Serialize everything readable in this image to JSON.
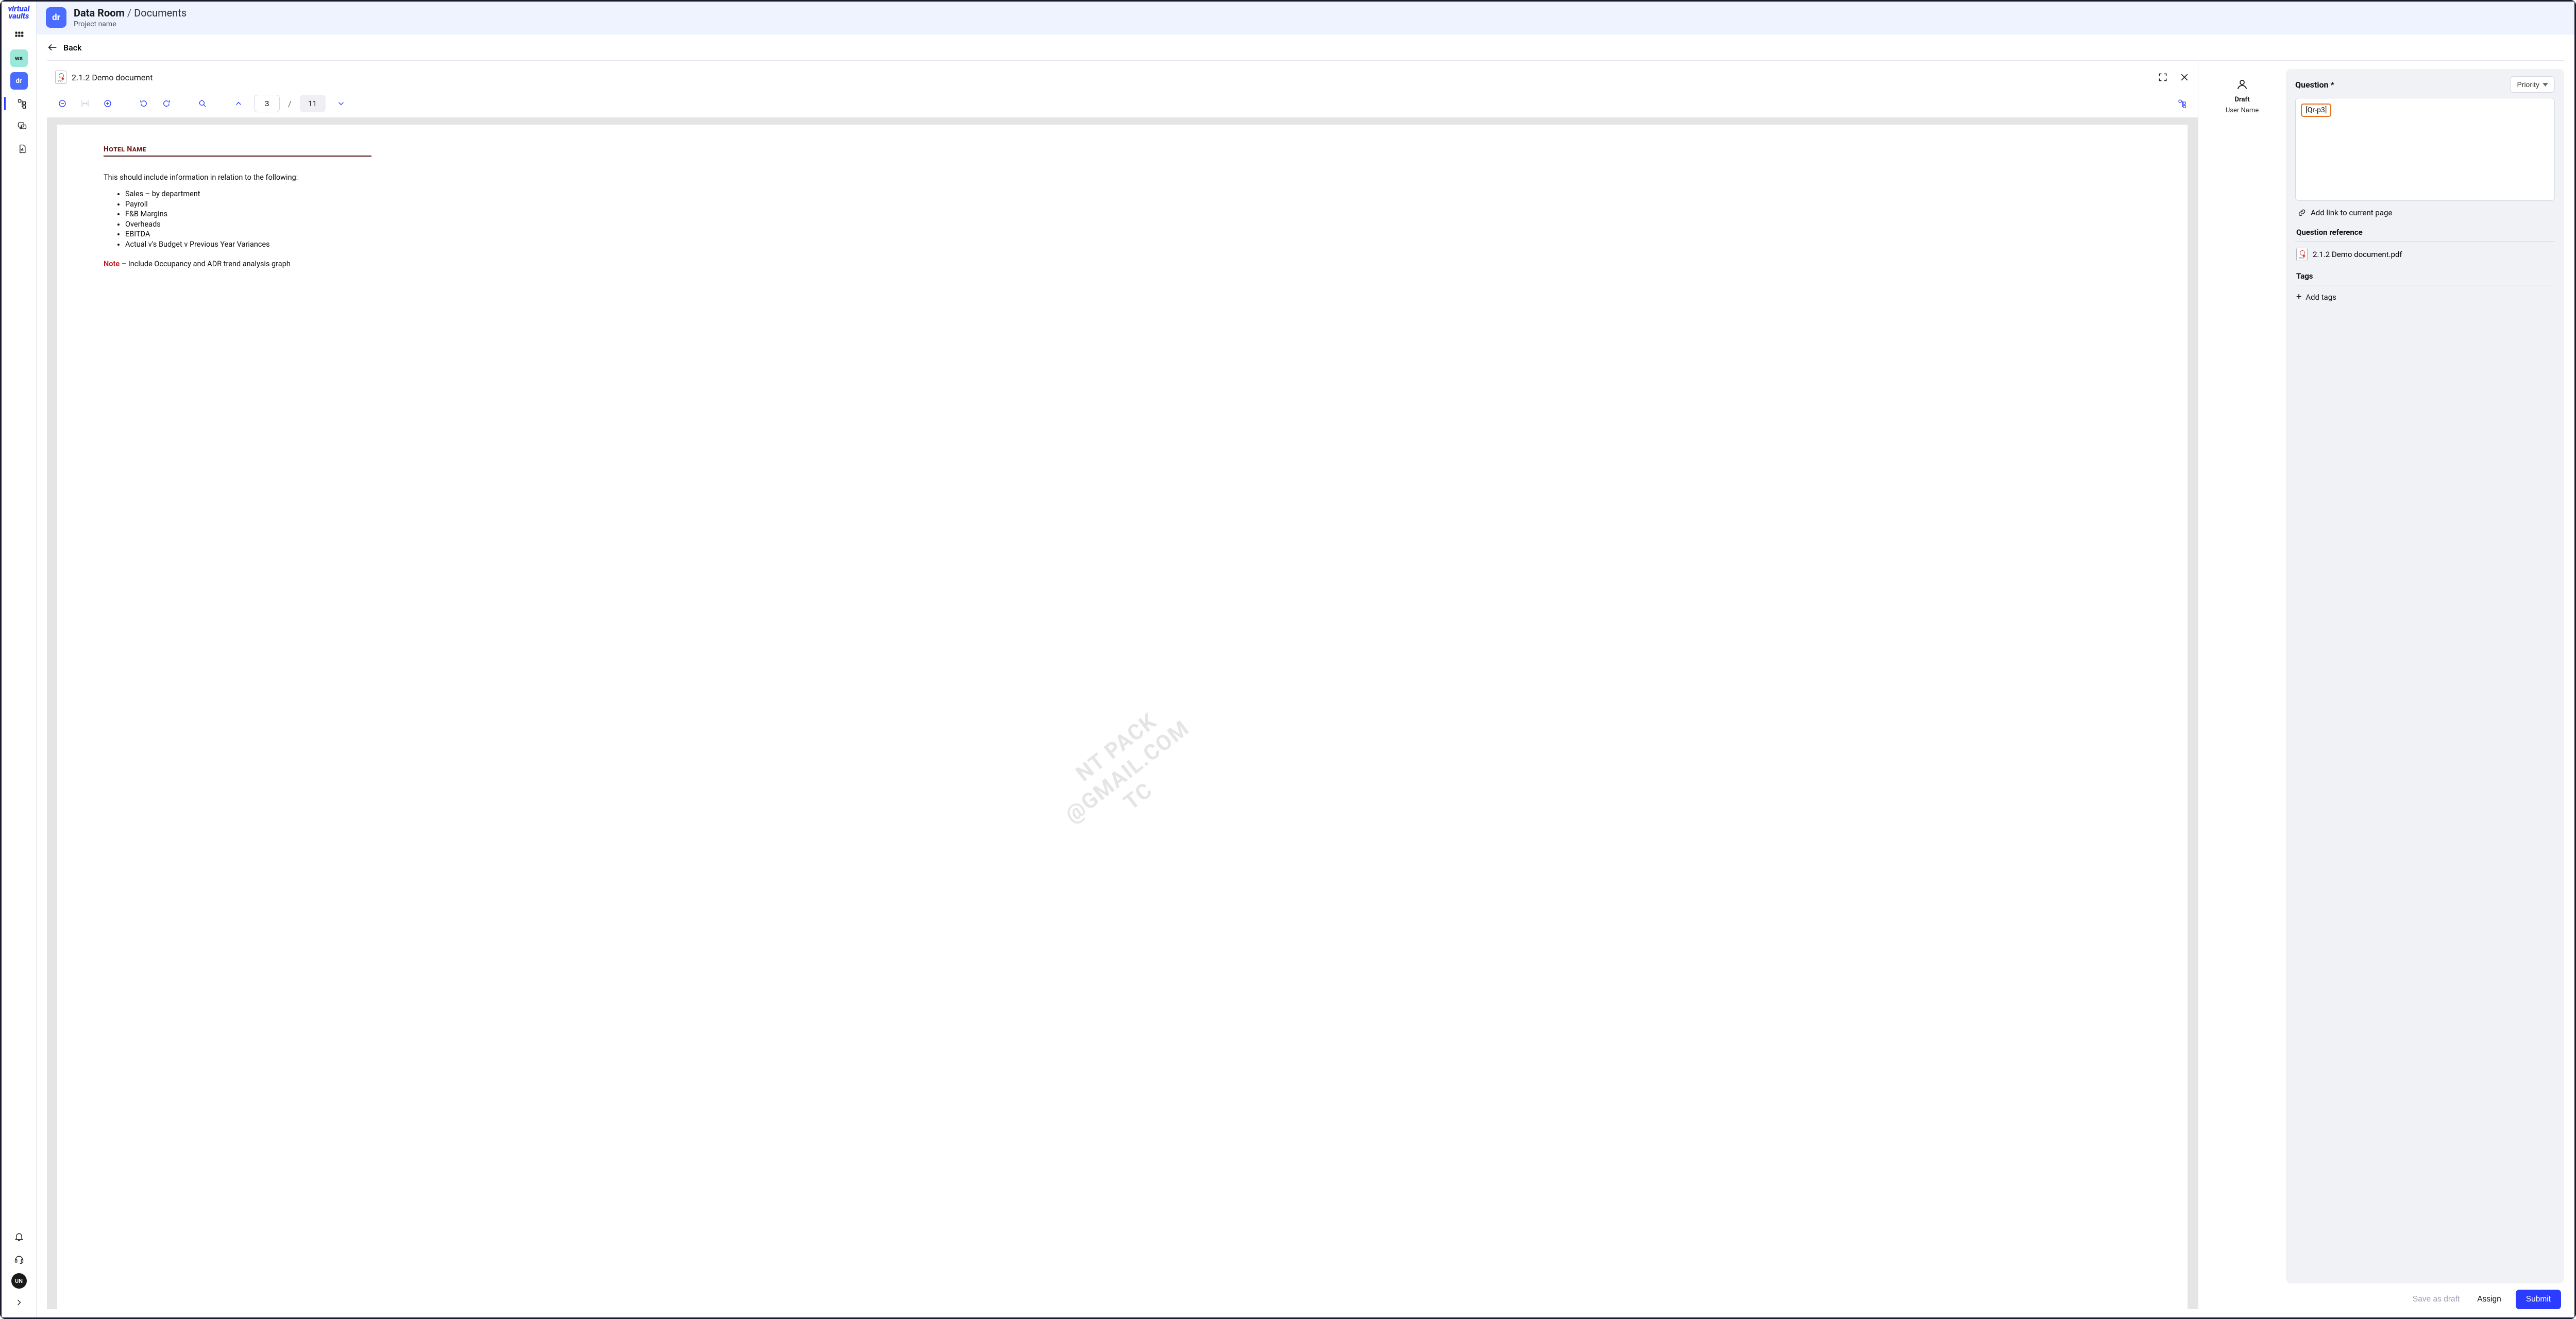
{
  "brand": {
    "line1": "virtual",
    "line2": "vaults"
  },
  "rail": {
    "ws_label": "ws",
    "dr_label": "dr",
    "un_label": "UN"
  },
  "header": {
    "badge": "dr",
    "crumb_root": "Data Room",
    "crumb_sep": "/",
    "crumb_leaf": "Documents",
    "project_name": "Project name"
  },
  "back_label": "Back",
  "viewer": {
    "doc_name": "2.1.2 Demo document",
    "page_current": "3",
    "page_total": "11"
  },
  "document_page": {
    "heading": "Hotel Name",
    "intro": "This should include information in relation to the following:",
    "bullets": [
      "Sales – by department",
      "Payroll",
      "F&B Margins",
      "Overheads",
      "EBITDA",
      "Actual v's Budget v Previous Year Variances"
    ],
    "note_keyword": "Note",
    "note_rest": " – Include Occupancy and ADR trend analysis graph",
    "watermark": "    NT PACK\n  @GMAIL.COM\nTC"
  },
  "meta": {
    "status": "Draft",
    "user": "User Name"
  },
  "question": {
    "title": "Question *",
    "priority_label": "Priority",
    "chip": "[Qr-p3]",
    "add_link_label": "Add link to current page",
    "reference_title": "Question reference",
    "reference_file": "2.1.2 Demo document.pdf",
    "tags_title": "Tags",
    "add_tags_label": "Add tags"
  },
  "actions": {
    "save_draft": "Save as draft",
    "assign": "Assign",
    "submit": "Submit"
  }
}
